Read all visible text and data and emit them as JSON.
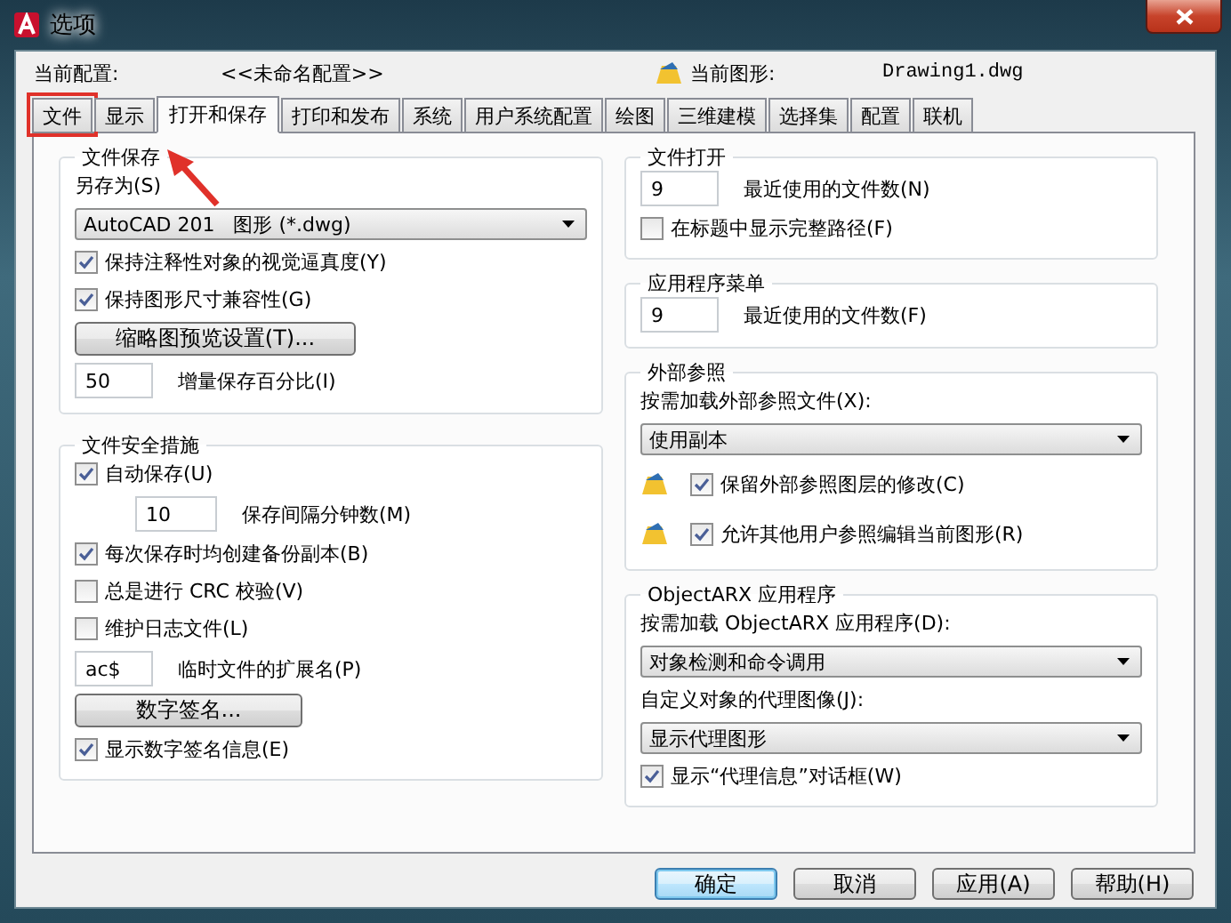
{
  "window": {
    "title": "选项"
  },
  "header": {
    "profile_label": "当前配置:",
    "profile_value": "<<未命名配置>>",
    "drawing_label": "当前图形:",
    "drawing_value": "Drawing1.dwg"
  },
  "tabs": [
    {
      "label": "文件",
      "selected": false,
      "annotated": true
    },
    {
      "label": "显示",
      "selected": false,
      "annotated": false
    },
    {
      "label": "打开和保存",
      "selected": true,
      "annotated": false
    },
    {
      "label": "打印和发布",
      "selected": false,
      "annotated": false
    },
    {
      "label": "系统",
      "selected": false,
      "annotated": false
    },
    {
      "label": "用户系统配置",
      "selected": false,
      "annotated": false
    },
    {
      "label": "绘图",
      "selected": false,
      "annotated": false
    },
    {
      "label": "三维建模",
      "selected": false,
      "annotated": false
    },
    {
      "label": "选择集",
      "selected": false,
      "annotated": false
    },
    {
      "label": "配置",
      "selected": false,
      "annotated": false
    },
    {
      "label": "联机",
      "selected": false,
      "annotated": false
    }
  ],
  "left_groups": [
    {
      "title": "文件保存",
      "items": [
        {
          "kind": "label",
          "text": "另存为(S)"
        },
        {
          "kind": "dropdown",
          "value": "AutoCAD 201   图形 (*.dwg)"
        },
        {
          "kind": "checkbox",
          "label": "保持注释性对象的视觉逼真度(Y)",
          "checked": true
        },
        {
          "kind": "checkbox",
          "label": "保持图形尺寸兼容性(G)",
          "checked": true
        },
        {
          "kind": "button",
          "label": "缩略图预览设置(T)..."
        },
        {
          "kind": "field",
          "value": "50",
          "caption": "增量保存百分比(I)"
        }
      ]
    },
    {
      "title": "文件安全措施",
      "items": [
        {
          "kind": "checkbox",
          "label": "自动保存(U)",
          "checked": true
        },
        {
          "kind": "indented_field",
          "value": "10",
          "caption": "保存间隔分钟数(M)"
        },
        {
          "kind": "checkbox",
          "label": "每次保存时均创建备份副本(B)",
          "checked": true
        },
        {
          "kind": "checkbox",
          "label": "总是进行 CRC 校验(V)",
          "checked": false
        },
        {
          "kind": "checkbox",
          "label": "维护日志文件(L)",
          "checked": false
        },
        {
          "kind": "field",
          "value": "ac$",
          "caption": "临时文件的扩展名(P)"
        },
        {
          "kind": "button",
          "label": "数字签名..."
        },
        {
          "kind": "checkbox",
          "label": "显示数字签名信息(E)",
          "checked": true
        }
      ]
    }
  ],
  "right_groups": [
    {
      "title": "文件打开",
      "items": [
        {
          "kind": "field",
          "value": "9",
          "caption": "最近使用的文件数(N)"
        },
        {
          "kind": "checkbox",
          "label": "在标题中显示完整路径(F)",
          "checked": false
        }
      ]
    },
    {
      "title": "应用程序菜单",
      "items": [
        {
          "kind": "field",
          "value": "9",
          "caption": "最近使用的文件数(F)"
        }
      ]
    },
    {
      "title": "外部参照",
      "items": [
        {
          "kind": "label",
          "text": "按需加载外部参照文件(X):"
        },
        {
          "kind": "dropdown",
          "value": "使用副本"
        },
        {
          "kind": "icon_checkbox",
          "label": "保留外部参照图层的修改(C)",
          "checked": true
        },
        {
          "kind": "icon_checkbox",
          "label": "允许其他用户参照编辑当前图形(R)",
          "checked": true
        }
      ]
    },
    {
      "title": "ObjectARX 应用程序",
      "items": [
        {
          "kind": "label",
          "text": "按需加载 ObjectARX 应用程序(D):"
        },
        {
          "kind": "dropdown",
          "value": "对象检测和命令调用"
        },
        {
          "kind": "label",
          "text": "自定义对象的代理图像(J):"
        },
        {
          "kind": "dropdown",
          "value": "显示代理图形"
        },
        {
          "kind": "checkbox",
          "label": "显示“代理信息”对话框(W)",
          "checked": true
        }
      ]
    }
  ],
  "buttons": [
    {
      "label": "确定",
      "default": true
    },
    {
      "label": "取消",
      "default": false
    },
    {
      "label": "应用(A)",
      "default": false
    },
    {
      "label": "帮助(H)",
      "default": false
    }
  ]
}
